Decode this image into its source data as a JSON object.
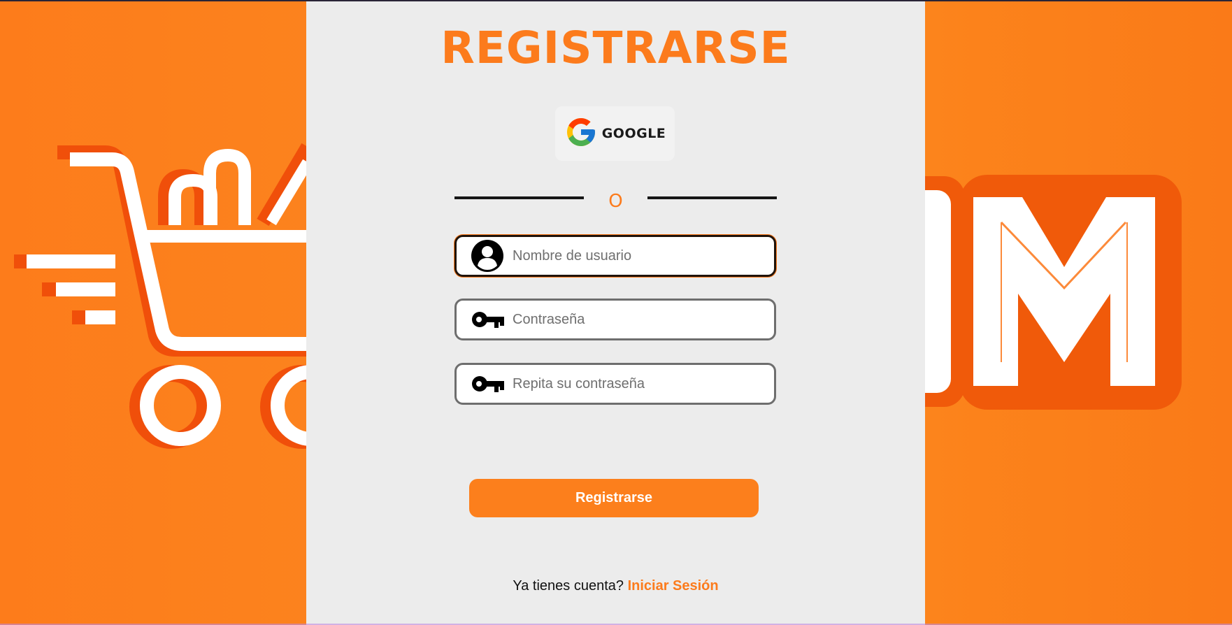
{
  "background": {
    "brand_color": "#fc7b1c",
    "brand_dark": "#f05a0a",
    "left_graphic": "shopping-cart-icon",
    "right_graphic_letters": "OM"
  },
  "form": {
    "title": "REGISTRARSE",
    "google_label": "GOOGLE",
    "google_icon": "google-icon",
    "divider_text": "O",
    "username_placeholder": "Nombre de usuario",
    "password_placeholder": "Contraseña",
    "repeat_password_placeholder": "Repita su contraseña",
    "submit_label": "Registrarse",
    "login_prompt": "Ya tienes cuenta?",
    "login_link": "Iniciar Sesión"
  }
}
